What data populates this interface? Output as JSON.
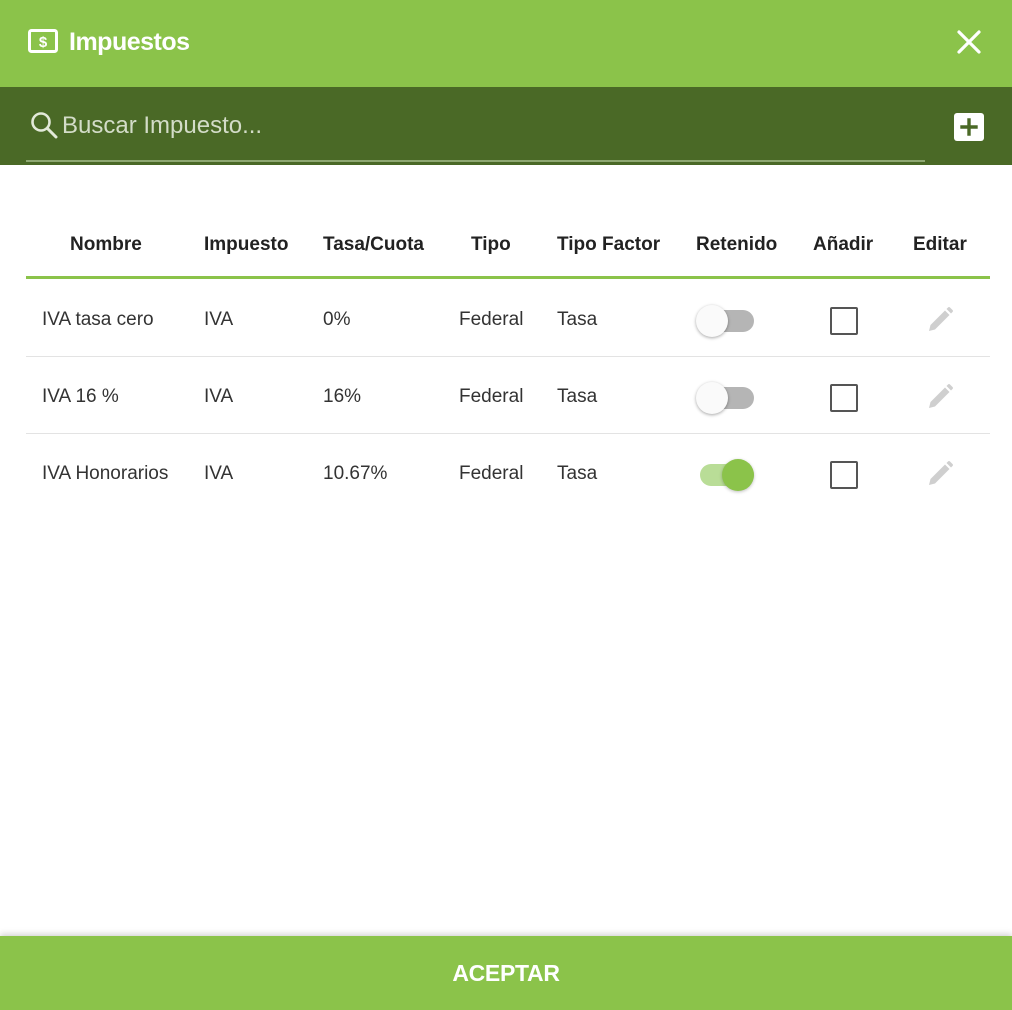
{
  "dialog": {
    "title": "Impuestos",
    "title_icon": "money-icon",
    "close_icon": "close-icon"
  },
  "search": {
    "placeholder": "Buscar Impuesto...",
    "value": "",
    "icon": "search-icon",
    "add_icon": "add-box-icon"
  },
  "table": {
    "headers": {
      "nombre": "Nombre",
      "impuesto": "Impuesto",
      "tasa": "Tasa/Cuota",
      "tipo": "Tipo",
      "tipo_factor": "Tipo Factor",
      "retenido": "Retenido",
      "anadir": "Añadir",
      "editar": "Editar"
    },
    "rows": [
      {
        "nombre": "IVA tasa cero",
        "impuesto": "IVA",
        "tasa": "0%",
        "tipo": "Federal",
        "tipo_factor": "Tasa",
        "retenido": false,
        "anadir": false,
        "edit_icon": "pencil-icon"
      },
      {
        "nombre": "IVA 16 %",
        "impuesto": "IVA",
        "tasa": "16%",
        "tipo": "Federal",
        "tipo_factor": "Tasa",
        "retenido": false,
        "anadir": false,
        "edit_icon": "pencil-icon"
      },
      {
        "nombre": "IVA Honorarios",
        "impuesto": "IVA",
        "tasa": "10.67%",
        "tipo": "Federal",
        "tipo_factor": "Tasa",
        "retenido": true,
        "anadir": false,
        "edit_icon": "pencil-icon"
      }
    ]
  },
  "footer": {
    "accept_label": "ACEPTAR"
  },
  "colors": {
    "primary": "#8bc34a",
    "primary_dark": "#4a6926",
    "toggle_on": "#8bc34a",
    "toggle_off": "#b5b5b5"
  }
}
